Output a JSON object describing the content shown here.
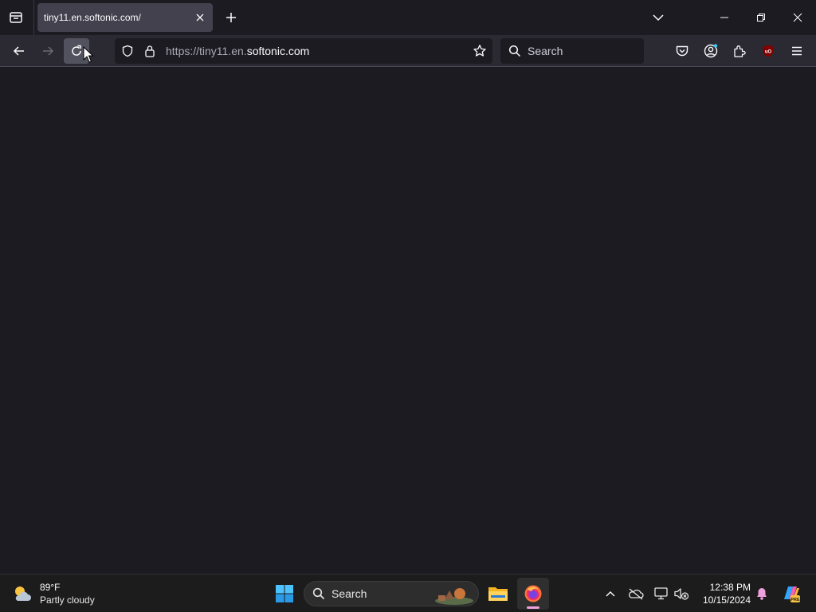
{
  "browser": {
    "tab": {
      "title": "tiny11.en.softonic.com/"
    },
    "urlbar": {
      "url_prefix": "https://tiny11.en.",
      "url_domain": "softonic.com"
    },
    "search": {
      "placeholder": "Search"
    }
  },
  "taskbar": {
    "weather": {
      "temp": "89°F",
      "condition": "Partly cloudy"
    },
    "search": {
      "placeholder": "Search"
    },
    "clock": {
      "time": "12:38 PM",
      "date": "10/15/2024"
    }
  },
  "colors": {
    "toolbar_bg": "#2b2a33",
    "content_bg": "#1c1b22",
    "taskbar_bg": "#1c1c1c",
    "ublock_red": "#800000"
  },
  "icons": [
    "tab-list-icon",
    "close-icon",
    "plus-icon",
    "chevron-down-icon",
    "minimize-icon",
    "restore-icon",
    "window-close-icon",
    "back-arrow-icon",
    "forward-arrow-icon",
    "reload-icon",
    "shield-icon",
    "lock-icon",
    "star-icon",
    "search-icon",
    "pocket-icon",
    "account-icon",
    "extensions-icon",
    "ublock-icon",
    "menu-icon",
    "weather-icon",
    "windows-start-icon",
    "file-explorer-icon",
    "firefox-icon",
    "chevron-up-icon",
    "onedrive-icon",
    "network-icon",
    "volume-muted-icon",
    "notification-bell-icon",
    "copilot-icon"
  ]
}
